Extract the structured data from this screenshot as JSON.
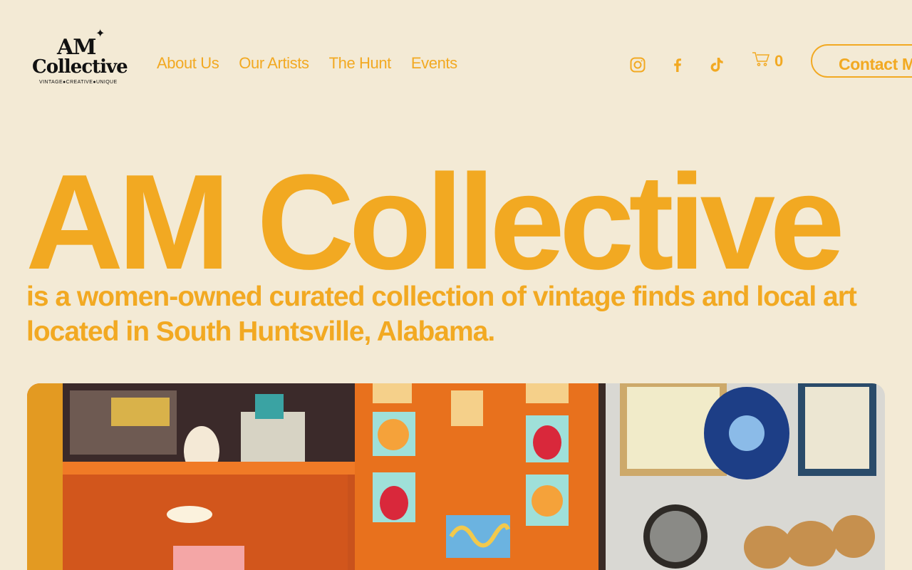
{
  "logo": {
    "line1": "AM",
    "line2": "Collective",
    "tagline": "VINTAGE●CREATIVE●UNIQUE"
  },
  "nav": {
    "items": [
      {
        "label": "About Us"
      },
      {
        "label": "Our Artists"
      },
      {
        "label": "The Hunt"
      },
      {
        "label": "Events"
      }
    ]
  },
  "social": {
    "icons": [
      "instagram-icon",
      "facebook-icon",
      "tiktok-icon"
    ]
  },
  "cart": {
    "count": "0"
  },
  "contact": {
    "label": "Contact Me"
  },
  "hero": {
    "title": "AM Collective",
    "subtitle": "is a women-owned curated collection of vintage finds and local art located in South Huntsville, Alabama."
  },
  "colors": {
    "background": "#f3ead5",
    "accent": "#f2a922",
    "logo": "#111111"
  }
}
